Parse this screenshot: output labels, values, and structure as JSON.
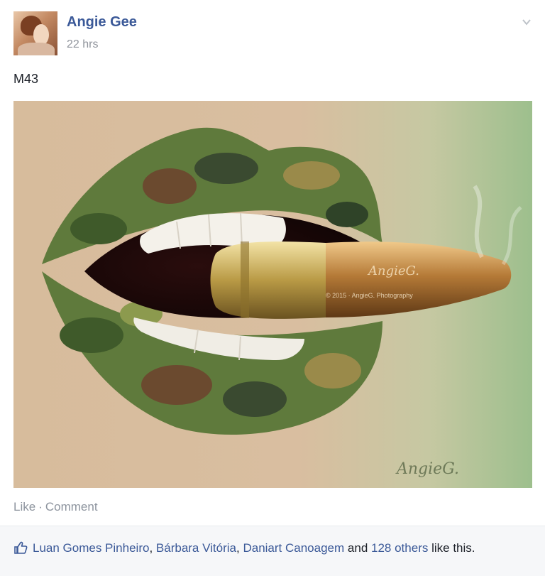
{
  "post": {
    "author": "Angie Gee",
    "time": "22 hrs",
    "text": "M43",
    "photo": {
      "alt_icon": "photo",
      "watermark_main": "AngieG.",
      "watermark_credit": "© 2015 · AngieG. Photography",
      "signature": "AngieG."
    }
  },
  "actions": {
    "like": "Like",
    "separator": "·",
    "comment": "Comment"
  },
  "likes": {
    "names": [
      "Luan Gomes Pinheiro",
      "Bárbara Vitória",
      "Daniart Canoagem"
    ],
    "comma": ",",
    "and_text": "and",
    "others": "128 others",
    "suffix": "like this."
  },
  "colors": {
    "link": "#3b5998",
    "meta": "#90949c",
    "bar_bg": "#f6f7f9"
  },
  "icons": {
    "menu": "chevron-down-icon",
    "like": "thumbs-up-icon"
  }
}
